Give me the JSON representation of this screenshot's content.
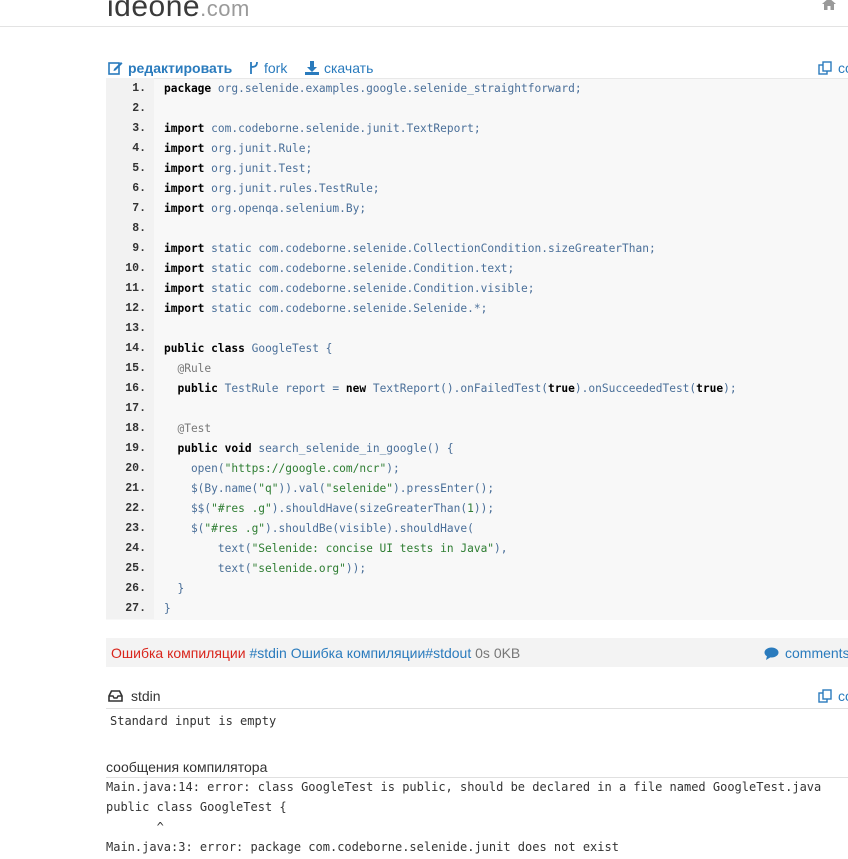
{
  "header": {
    "logo_main": "ideone",
    "logo_suffix": ".com",
    "home_icon": "home-icon"
  },
  "toolbar": {
    "edit_label": "редактировать",
    "fork_label": "fork",
    "download_label": "скачать",
    "copy_label": "co"
  },
  "code_lines": [
    {
      "n": "1."
    },
    {
      "n": "2."
    },
    {
      "n": "3."
    },
    {
      "n": "4."
    },
    {
      "n": "5."
    },
    {
      "n": "6."
    },
    {
      "n": "7."
    },
    {
      "n": "8."
    },
    {
      "n": "9."
    },
    {
      "n": "10."
    },
    {
      "n": "11."
    },
    {
      "n": "12."
    },
    {
      "n": "13."
    },
    {
      "n": "14."
    },
    {
      "n": "15."
    },
    {
      "n": "16."
    },
    {
      "n": "17."
    },
    {
      "n": "18."
    },
    {
      "n": "19."
    },
    {
      "n": "20."
    },
    {
      "n": "21."
    },
    {
      "n": "22."
    },
    {
      "n": "23."
    },
    {
      "n": "24."
    },
    {
      "n": "25."
    },
    {
      "n": "26."
    },
    {
      "n": "27."
    }
  ],
  "code": {
    "l1_kw": "package",
    "l1_rest": " org.selenide.examples.google.selenide_straightforward;",
    "import_kw": "import",
    "static_kw": "static",
    "l3": " com.codeborne.selenide.junit.TextReport;",
    "l4": " org.junit.Rule;",
    "l5": " org.junit.Test;",
    "l6": " org.junit.rules.TestRule;",
    "l7": " org.openqa.selenium.By;",
    "l9": " com.codeborne.selenide.CollectionCondition.sizeGreaterThan;",
    "l10": " com.codeborne.selenide.Condition.text;",
    "l11": " com.codeborne.selenide.Condition.visible;",
    "l12": " com.codeborne.selenide.Selenide.*;",
    "l14_kw1": "public",
    "l14_kw2": "class",
    "l14_rest": " GoogleTest {",
    "l15": "  @Rule",
    "l16_kw": "  public",
    "l16_a": " TestRule report = ",
    "l16_new": "new",
    "l16_b": " TextReport().onFailedTest(",
    "l16_true1": "true",
    "l16_c": ").onSucceededTest(",
    "l16_true2": "true",
    "l16_d": ");",
    "l18": "  @Test",
    "l19_kw1": "  public",
    "l19_kw2": "void",
    "l19_rest": " search_selenide_in_google() {",
    "l20_a": "    open(",
    "l20_s": "\"https://google.com/ncr\"",
    "l20_b": ");",
    "l21_a": "    $(By.name(",
    "l21_s1": "\"q\"",
    "l21_b": ")).val(",
    "l21_s2": "\"selenide\"",
    "l21_c": ").pressEnter();",
    "l22_a": "    $$(",
    "l22_s": "\"#res .g\"",
    "l22_b": ").shouldHave(sizeGreaterThan(",
    "l22_n": "1",
    "l22_c": "));",
    "l23_a": "    $(",
    "l23_s": "\"#res .g\"",
    "l23_b": ").shouldBe(visible).shouldHave(",
    "l24_a": "        text(",
    "l24_s": "\"Selenide: concise UI tests in Java\"",
    "l24_b": "),",
    "l25_a": "        text(",
    "l25_s": "\"selenide.org\"",
    "l25_b": "));",
    "l26": "  }",
    "l27": "}"
  },
  "status": {
    "compile_error_1": "Ошибка компиляции",
    "stdin_link": "#stdin",
    "compile_error_2": "Ошибка компиляции",
    "stdout_link": "#stdout",
    "time": "0s",
    "memory": "0KB",
    "comments_label": "comments"
  },
  "stdin": {
    "title": "stdin",
    "body": "Standard input is empty"
  },
  "compiler": {
    "title": "сообщения компилятора",
    "lines": [
      "Main.java:14: error: class GoogleTest is public, should be declared in a file named GoogleTest.java",
      "public class GoogleTest {",
      "       ^",
      "Main.java:3: error: package com.codeborne.selenide.junit does not exist"
    ]
  },
  "colors": {
    "link": "#2a7bbd",
    "error": "#d9251c",
    "code_bg": "#f8f8f8"
  }
}
